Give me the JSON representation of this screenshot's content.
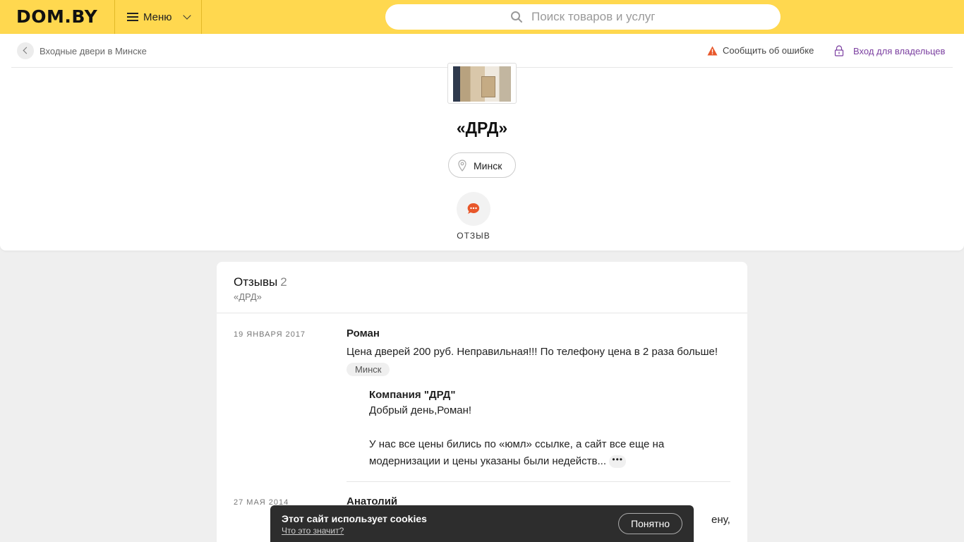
{
  "header": {
    "logo": "DOM.BY",
    "menu_label": "Меню",
    "search_placeholder": "Поиск товаров и услуг"
  },
  "nav": {
    "breadcrumb": "Входные двери в Минске",
    "report_label": "Сообщить об ошибке",
    "owner_label": "Вход для владельцев"
  },
  "company": {
    "name": "«ДРД»",
    "city": "Минск",
    "review_button_label": "ОТЗЫВ"
  },
  "reviews": {
    "heading": "Отзывы",
    "count": "2",
    "subtitle": "«ДРД»",
    "items": [
      {
        "date": "19 ЯНВАРЯ 2017",
        "author": "Роман",
        "text": "Цена дверей 200 руб. Неправильная!!! По телефону цена в 2 раза больше!",
        "tag": "Минск",
        "reply": {
          "author": "Компания \"ДРД\"",
          "line1": "Добрый день,Роман!",
          "line2": "У нас все цены бились по «юмл» ссылке, а сайт все еще на",
          "line3": "модернизации и цены указаны были недейств...",
          "more": "•••"
        }
      },
      {
        "date": "27 МАЯ 2014",
        "author": "Анатолий",
        "text_visible_end": "ену,"
      }
    ]
  },
  "cookie": {
    "title": "Этот сайт использует cookies",
    "link": "Что это значит?",
    "button": "Понятно"
  },
  "colors": {
    "header_bg": "#ffd84f",
    "owner_link": "#7b3fa0",
    "accent_orange": "#e8572a"
  }
}
